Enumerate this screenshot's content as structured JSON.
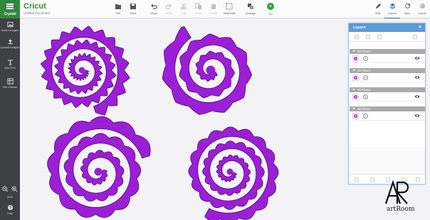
{
  "app": {
    "brand": "Cricut",
    "document_title": "Untitled Document",
    "account_menu_label": "Crystal"
  },
  "toolbar": {
    "items": [
      {
        "label": "File",
        "icon": "folder-icon",
        "enabled": true,
        "dropdown": true
      },
      {
        "label": "Save",
        "icon": "save-icon",
        "enabled": true
      },
      {
        "label": "Undo",
        "icon": "undo-icon",
        "enabled": true
      },
      {
        "label": "Redo",
        "icon": "redo-icon",
        "enabled": false
      },
      {
        "label": "Cut",
        "icon": "cut-icon",
        "enabled": false
      },
      {
        "label": "Copy",
        "icon": "copy-icon",
        "enabled": false
      },
      {
        "label": "Paste",
        "icon": "paste-icon",
        "enabled": false
      },
      {
        "label": "Select All",
        "icon": "select-all-icon",
        "enabled": true
      },
      {
        "label": "Arrange",
        "icon": "arrange-icon",
        "enabled": true,
        "dropdown": true
      }
    ],
    "go_button_letter": "G",
    "go_label": "Go"
  },
  "right_tabs": [
    {
      "label": "Edit",
      "icon": "pencil-icon",
      "active": false
    },
    {
      "label": "Layers",
      "icon": "layers-icon",
      "active": true
    },
    {
      "label": "Sync",
      "icon": "sync-icon",
      "active": false
    },
    {
      "label": "Colors",
      "icon": "palette-icon",
      "active": false
    }
  ],
  "sidebar": {
    "items": [
      {
        "label": "Insert Images",
        "icon": "image-icon"
      },
      {
        "label": "Upload Images",
        "icon": "upload-icon"
      },
      {
        "label": "Add Text",
        "icon": "text-icon"
      },
      {
        "label": "Set Canvas",
        "icon": "canvas-icon"
      }
    ],
    "zoom_in_icon": "zoom-in-icon",
    "zoom_out_icon": "zoom-out-icon",
    "zoom_value": "90%",
    "help_label": "Help"
  },
  "layers_panel": {
    "title": "Layers",
    "close_icon": "close-icon",
    "groups": [
      {
        "label": "3D Flower",
        "visible": true
      },
      {
        "label": "3D Flower",
        "visible": true
      },
      {
        "label": "3D Flower",
        "visible": true
      },
      {
        "label": "3D Flower",
        "visible": true
      }
    ]
  },
  "canvas": {
    "shape_color": "#9a1fd6",
    "shape_stroke": "#4a0a70"
  },
  "watermark": {
    "logo_letters": "AR",
    "text": "artRoom"
  }
}
